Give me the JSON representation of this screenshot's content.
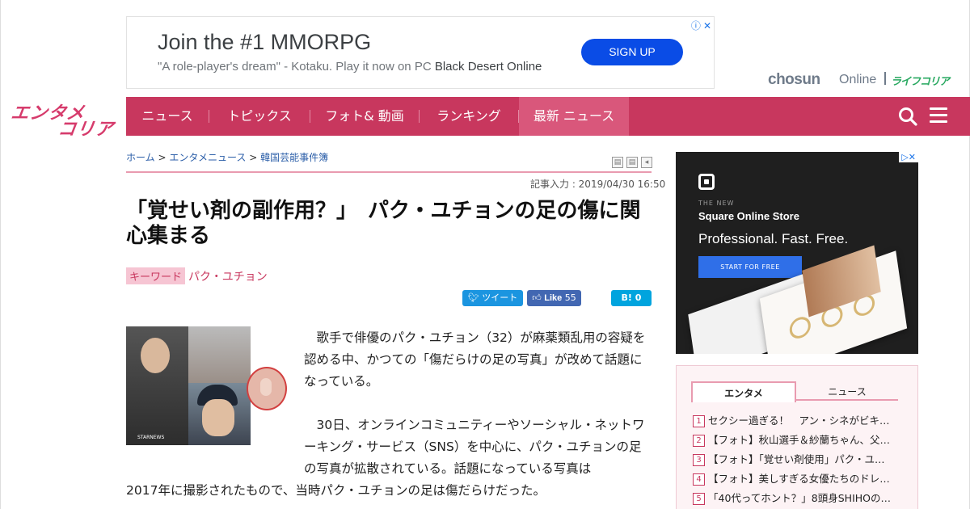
{
  "top_ad": {
    "title": "Join the #1 MMORPG",
    "desc": "\"A role-player's dream\" - Kotaku. Play it now on PC",
    "advertiser": "Black Desert Online",
    "cta": "SIGN UP",
    "info_icon": "info-icon",
    "close_icon": "close-icon"
  },
  "brand": {
    "chosun": "chosun",
    "online": "Online",
    "life": "ライフコリア"
  },
  "logo": {
    "line1": "エンタメ",
    "line2": "コリア"
  },
  "nav": {
    "items": [
      "ニュース",
      "トピックス",
      "フォト& 動画",
      "ランキング",
      "最新 ニュース"
    ],
    "active_index": 4,
    "bg_color": "#c8375e",
    "active_color": "#d9577b"
  },
  "breadcrumb": {
    "home": "ホーム",
    "sep": " > ",
    "level1": "エンタメニュース",
    "level2": "韓国芸能事件簿"
  },
  "article": {
    "date": "記事入力 : 2019/04/30 16:50",
    "title": "「覚せい剤の副作用？」　パク・ユチョンの足の傷に関心集まる",
    "keyword_label": "キーワード",
    "keyword": "パク・ユチョン",
    "tweet": "ツイート",
    "like": "Like",
    "like_count": "55",
    "hatena": "B!",
    "hatena_count": "0",
    "p1": "　歌手で俳優のパク・ユチョン（32）が麻薬類乱用の容疑を認める中、かつての「傷だらけの足の写真」が改めて話題になっている。",
    "p2a": "　30日、オンラインコミュニティーやソーシャル・ネットワーキング・サービス（SNS）を中心に、パク・ユチョンの足の写真が拡散されている。話題になっている写真は",
    "p2b": "2017年に撮影されたもので、当時パク・ユチョンの足は傷だらけだった。",
    "photo_label": "STARNEWS"
  },
  "side_ad": {
    "the_new": "THE NEW",
    "store": "Square Online Store",
    "tagline": "Professional. Fast. Free.",
    "cta": "START FOR FREE"
  },
  "ranking": {
    "tabs": [
      "エンタメ",
      "ニュース"
    ],
    "items": [
      {
        "n": "1",
        "text": "セクシー過ぎる！　アン・シネがビキ…"
      },
      {
        "n": "2",
        "text": "【フォト】秋山選手＆紗蘭ちゃん、父…"
      },
      {
        "n": "3",
        "text": "【フォト】「覚せい剤使用」パク・ユ…"
      },
      {
        "n": "4",
        "text": "【フォト】美しすぎる女優たちのドレ…"
      },
      {
        "n": "5",
        "text": "「40代ってホント？」8頭身SHIHOの…"
      }
    ]
  }
}
